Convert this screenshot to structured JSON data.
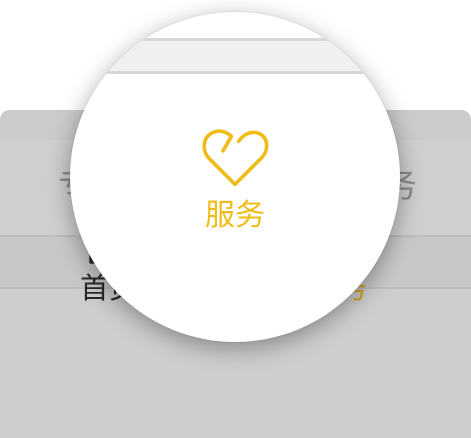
{
  "background_texts": {
    "left_partial": "专",
    "right_partial": "务",
    "top_left_partial": ""
  },
  "tabbar": {
    "tabs": [
      {
        "id": "home",
        "label": "首页",
        "icon": "house-icon",
        "active": false
      },
      {
        "id": "service",
        "label": "服务",
        "icon": "heart-icon",
        "active": true
      }
    ]
  },
  "magnifier": {
    "label": "服务",
    "icon": "heart-icon"
  },
  "colors": {
    "accent": "#f0bc1a",
    "accent_dimmed": "#d4a419",
    "text_dark": "#2a2a2a",
    "panel_gray": "#cfcfcf"
  }
}
